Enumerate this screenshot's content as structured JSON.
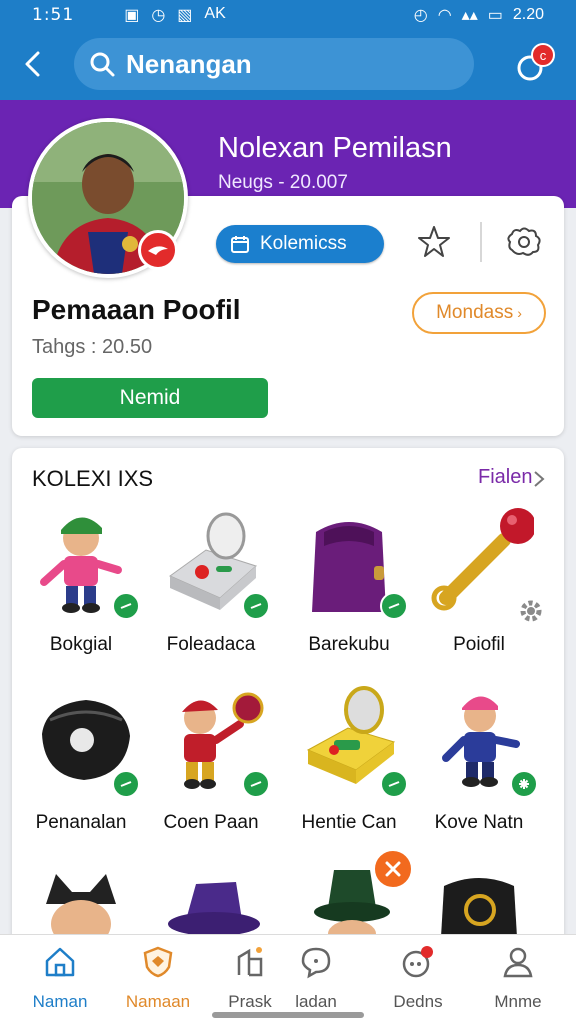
{
  "status_bar": {
    "time": "1:51",
    "right_time": "2.20",
    "left_icons": [
      "0",
      "timer",
      "settings",
      "AK"
    ]
  },
  "search": {
    "value": "Nenangan",
    "notification_badge": "c"
  },
  "hero": {
    "name": "Nolexan Pemilasn",
    "subtitle": "Neugs - 20.007"
  },
  "profile": {
    "chip_label": "Kolemicss",
    "title": "Pemaaan Poofil",
    "subtitle": "Tahgs : 20.50",
    "secondary_button": "Mondass",
    "primary_button": "Nemid"
  },
  "collection": {
    "title": "KOLEXI IXS",
    "link": "Fialen",
    "items": [
      {
        "label": "Bokgial",
        "icon": "figure-icon"
      },
      {
        "label": "Foleadaca",
        "icon": "device-icon"
      },
      {
        "label": "Barekubu",
        "icon": "bag-icon"
      },
      {
        "label": "Poiofil",
        "icon": "scepter-icon"
      },
      {
        "label": "Penanalan",
        "icon": "pouch-icon"
      },
      {
        "label": "Coen Paan",
        "icon": "figure-icon"
      },
      {
        "label": "Hentie Can",
        "icon": "device-icon"
      },
      {
        "label": "Kove Natn",
        "icon": "figure-icon"
      },
      {
        "label": "",
        "icon": "figure-icon"
      },
      {
        "label": "",
        "icon": "hat-icon"
      },
      {
        "label": "",
        "icon": "figure-icon"
      },
      {
        "label": "",
        "icon": "bag-icon"
      }
    ]
  },
  "bottom_nav": [
    {
      "label": "Naman",
      "active": true
    },
    {
      "label": "Namaan"
    },
    {
      "label": "Prask"
    },
    {
      "label": "ladan"
    },
    {
      "label": "Dedns"
    },
    {
      "label": "Mnme"
    }
  ],
  "colors": {
    "primary_blue": "#1e7ec8",
    "purple": "#6b24b3",
    "green": "#1f9e4a",
    "orange": "#f2a23a",
    "link_purple": "#7a2aa8"
  }
}
